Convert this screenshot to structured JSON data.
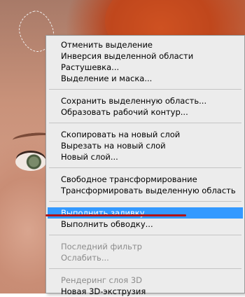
{
  "context_menu": {
    "groups": [
      {
        "items": [
          {
            "label": "Отменить выделение",
            "enabled": true
          },
          {
            "label": "Инверсия выделенной области",
            "enabled": true
          },
          {
            "label": "Растушевка...",
            "enabled": true
          },
          {
            "label": "Выделение и маска...",
            "enabled": true
          }
        ]
      },
      {
        "items": [
          {
            "label": "Сохранить выделенную область...",
            "enabled": true
          },
          {
            "label": "Образовать рабочий контур...",
            "enabled": true
          }
        ]
      },
      {
        "items": [
          {
            "label": "Скопировать на новый слой",
            "enabled": true
          },
          {
            "label": "Вырезать на новый слой",
            "enabled": true
          },
          {
            "label": "Новый слой...",
            "enabled": true
          }
        ]
      },
      {
        "items": [
          {
            "label": "Свободное трансформирование",
            "enabled": true
          },
          {
            "label": "Трансформировать выделенную область",
            "enabled": true
          }
        ]
      },
      {
        "items": [
          {
            "label": "Выполнить заливку...",
            "enabled": true,
            "highlighted": true
          },
          {
            "label": "Выполнить обводку...",
            "enabled": true
          }
        ]
      },
      {
        "items": [
          {
            "label": "Последний фильтр",
            "enabled": false
          },
          {
            "label": "Ослабить...",
            "enabled": false
          }
        ]
      },
      {
        "items": [
          {
            "label": "Рендеринг слоя 3D",
            "enabled": false
          },
          {
            "label": "Новая 3D-экструзия",
            "enabled": true
          }
        ]
      }
    ]
  },
  "colors": {
    "highlight": "#3399ff",
    "annotation": "#b01212",
    "menu_background": "#ececec",
    "disabled_text": "#8c8c8c"
  }
}
